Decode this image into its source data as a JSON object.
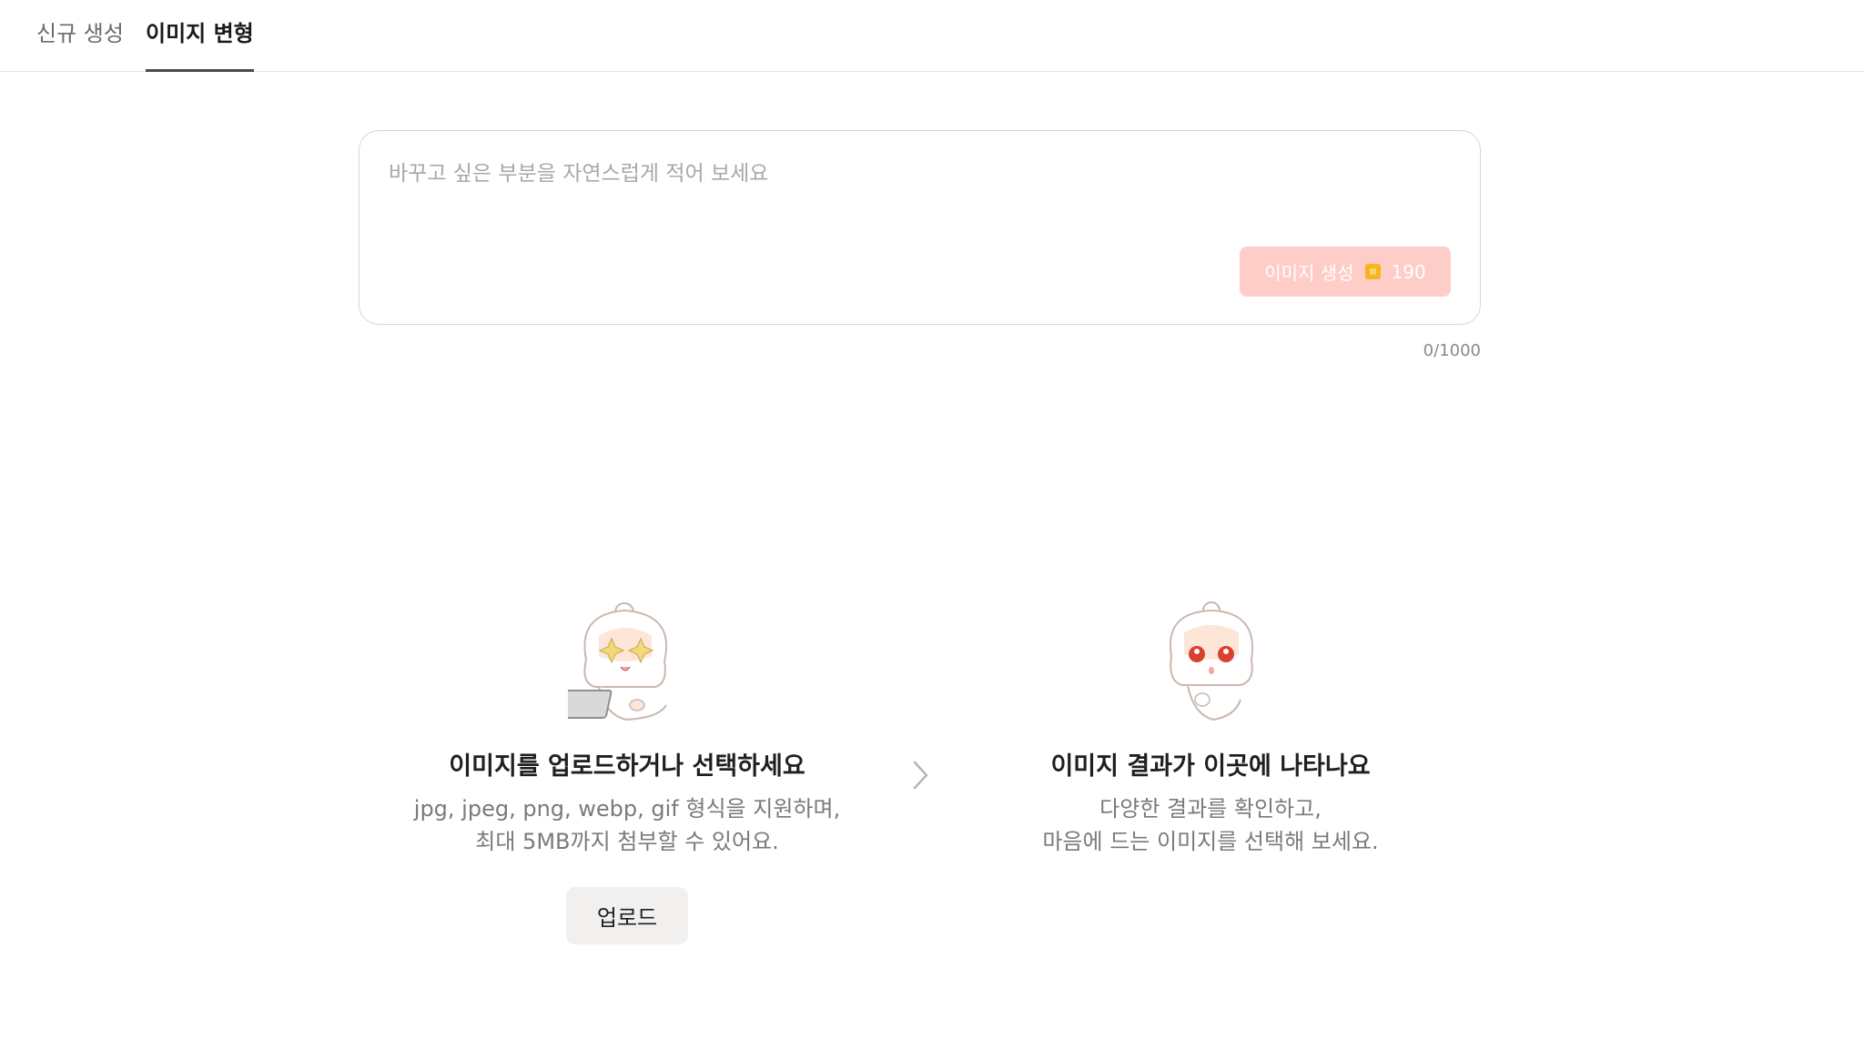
{
  "tabs": [
    {
      "label": "신규 생성",
      "active": false
    },
    {
      "label": "이미지 변형",
      "active": true
    }
  ],
  "prompt": {
    "placeholder": "바꾸고 싶은 부분을 자연스럽게 적어 보세요",
    "value": "",
    "char_count": "0/1000"
  },
  "generate_button": {
    "label": "이미지 생성",
    "cost": "190",
    "icon": "coin-icon",
    "color": "#ffcdc8"
  },
  "upload_panel": {
    "title": "이미지를 업로드하거나 선택하세요",
    "desc_line1": "jpg, jpeg, png, webp, gif 형식을 지원하며,",
    "desc_line2": "최대 5MB까지 첨부할 수 있어요.",
    "button_label": "업로드"
  },
  "result_panel": {
    "title": "이미지 결과가 이곳에 나타나요",
    "desc_line1": "다양한 결과를 확인하고,",
    "desc_line2": "마음에 드는 이미지를 선택해 보세요."
  }
}
